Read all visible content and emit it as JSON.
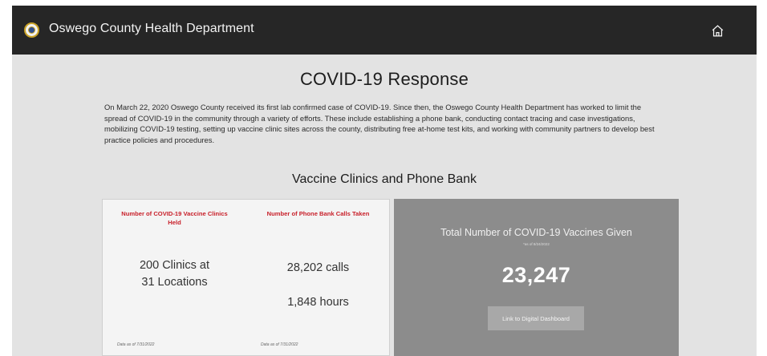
{
  "header": {
    "app_title": "Oswego County Health Department",
    "logo_icon": "county-seal-icon",
    "home_icon": "home-icon"
  },
  "main": {
    "title": "COVID-19 Response",
    "intro": "On March 22, 2020 Oswego County received its first lab confirmed case of COVID-19. Since then, the Oswego County Health Department has worked to limit the spread of COVID-19 in the community through a variety of efforts. These include establishing a phone bank, conducting contact tracing and case investigations, mobilizing COVID-19 testing, setting up vaccine clinic sites across the county, distributing free at-home test kits, and working with community partners to develop best practice policies and procedures.",
    "section_title": "Vaccine Clinics and Phone Bank"
  },
  "stats": {
    "clinics": {
      "header": "Number of COVID-19 Vaccine Clinics Held",
      "line1": "200 Clinics at",
      "line2": "31 Locations",
      "note": "Data as of 7/31/2022"
    },
    "phone_bank": {
      "header": "Number of Phone Bank Calls Taken",
      "calls": "28,202 calls",
      "hours": "1,848 hours",
      "note": "Data as of 7/31/2022"
    }
  },
  "vaccines": {
    "title": "Total Number of COVID-19 Vaccines Given",
    "as_of": "*as of 8/24/2022",
    "total": "23,247",
    "link_label": "Link to Digital Dashboard"
  },
  "colors": {
    "topbar": "#262626",
    "page_bg": "#e3e3e3",
    "header_red": "#c8202a",
    "vax_card": "#8c8c8c"
  }
}
